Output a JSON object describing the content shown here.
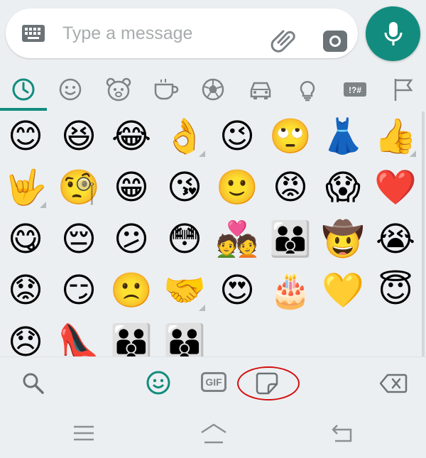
{
  "input": {
    "placeholder": "Type a message"
  },
  "categories": [
    "recent",
    "smileys-people",
    "animals-nature",
    "food-drink",
    "activity",
    "travel-places",
    "objects",
    "symbols",
    "flags"
  ],
  "emoji_rows": [
    [
      "😊",
      "😆",
      "😂",
      "👌",
      "😉",
      "🙄",
      "👗",
      "👍"
    ],
    [
      "🤟",
      "🧐",
      "😁",
      "😘",
      "🙂",
      "😡",
      "😱",
      "❤️"
    ],
    [
      "😋",
      "😔",
      "😕",
      "😳",
      "💑",
      "👪",
      "🤠",
      "😭"
    ],
    [
      "😟",
      "😏",
      "🙁",
      "🤝",
      "😍",
      "🎂",
      "💛",
      "😇"
    ],
    [
      "😞",
      "👠",
      "👪",
      "👪"
    ]
  ],
  "toolbar": {
    "gif_label": "GIF"
  },
  "colors": {
    "accent": "#128c7e",
    "highlight_ring": "#d10f0f"
  }
}
